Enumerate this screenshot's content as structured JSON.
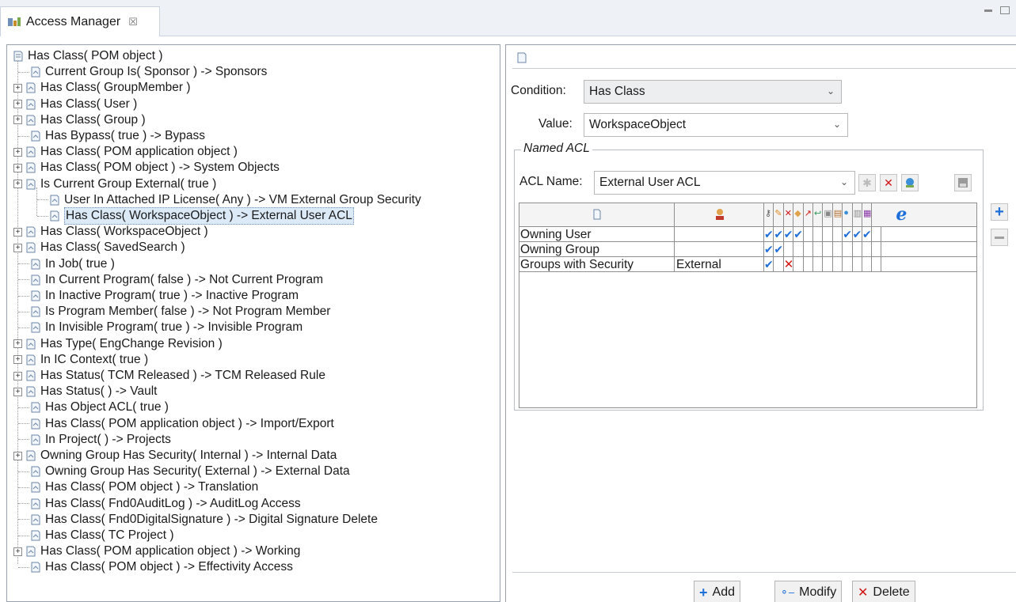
{
  "tab": {
    "title": "Access Manager",
    "close_glyph": "☒"
  },
  "tree": {
    "root": "Has Class( POM object )",
    "rows": [
      {
        "label": "Current Group Is( Sponsor ) -> Sponsors"
      },
      {
        "label": "Has Class( GroupMember )"
      },
      {
        "label": "Has Class( User )"
      },
      {
        "label": "Has Class( Group )"
      },
      {
        "label": "Has Bypass( true ) -> Bypass"
      },
      {
        "label": "Has Class( POM application object )"
      },
      {
        "label": "Has Class( POM object ) -> System Objects"
      },
      {
        "label": "Is Current Group External( true )"
      },
      {
        "label": "User In Attached IP License( Any ) -> VM External Group Security"
      },
      {
        "label": "Has Class( WorkspaceObject ) -> External User ACL"
      },
      {
        "label": "Has Class( WorkspaceObject )"
      },
      {
        "label": "Has Class( SavedSearch )"
      },
      {
        "label": "In Job( true )"
      },
      {
        "label": "In Current Program( false ) -> Not Current Program"
      },
      {
        "label": "In Inactive Program( true ) -> Inactive Program"
      },
      {
        "label": "Is Program Member( false ) -> Not Program Member"
      },
      {
        "label": "In Invisible Program( true ) -> Invisible Program"
      },
      {
        "label": "Has Type( EngChange Revision )"
      },
      {
        "label": "In IC Context( true )"
      },
      {
        "label": "Has Status( TCM Released ) -> TCM Released Rule"
      },
      {
        "label": "Has Status(  ) -> Vault"
      },
      {
        "label": "Has Object ACL( true )"
      },
      {
        "label": "Has Class( POM application object ) -> Import/Export"
      },
      {
        "label": "In Project(  ) -> Projects"
      },
      {
        "label": "Owning Group Has Security( Internal ) -> Internal Data"
      },
      {
        "label": "Owning Group Has Security( External ) -> External Data"
      },
      {
        "label": "Has Class( POM object ) -> Translation"
      },
      {
        "label": "Has Class( Fnd0AuditLog ) -> AuditLog Access"
      },
      {
        "label": "Has Class( Fnd0DigitalSignature ) -> Digital Signature Delete"
      },
      {
        "label": "Has Class( TC Project )"
      },
      {
        "label": "Has Class( POM application object ) -> Working"
      },
      {
        "label": "Has Class( POM object ) -> Effectivity Access"
      }
    ]
  },
  "form": {
    "condition_label": "Condition:",
    "condition_value": "Has Class",
    "value_label": "Value:",
    "value_value": "WorkspaceObject",
    "group_title": "Named ACL",
    "acl_name_label": "ACL Name:",
    "acl_name_value": "External User ACL"
  },
  "acl": {
    "rows": [
      {
        "accessor": "Owning User",
        "id": ""
      },
      {
        "accessor": "Owning Group",
        "id": ""
      },
      {
        "accessor": "Groups with Security",
        "id": "External"
      }
    ]
  },
  "buttons": {
    "add": "Add",
    "modify": "Modify",
    "delete": "Delete"
  },
  "colors": {
    "check": "#1e6fd9",
    "deny": "#d21414",
    "accent": "#1e6fd9"
  }
}
